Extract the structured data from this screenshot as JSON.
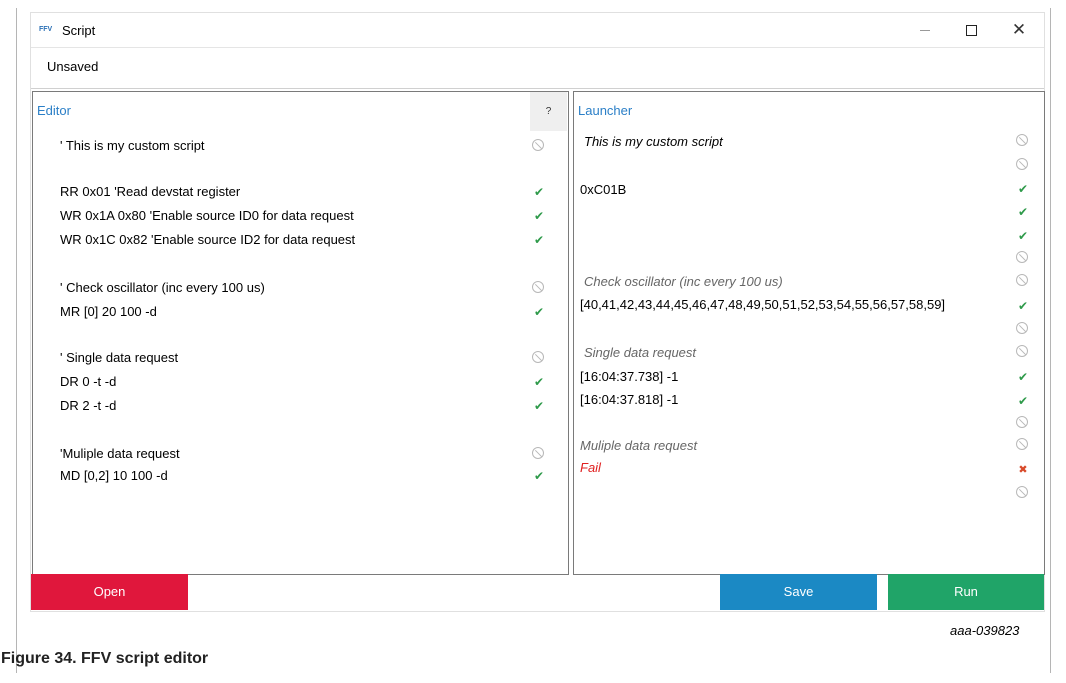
{
  "window": {
    "logo_text": "FFV",
    "title": "Script",
    "status": "Unsaved",
    "controls": {
      "minimize": "—",
      "maximize": "",
      "close": "✕"
    }
  },
  "editor": {
    "title": "Editor",
    "help_label": "?",
    "lines": [
      {
        "text": "' This is my custom script",
        "status": "skip"
      },
      {
        "text": "RR 0x01 'Read devstat register",
        "status": "ok"
      },
      {
        "text": "WR 0x1A 0x80 'Enable source ID0 for data request",
        "status": "ok"
      },
      {
        "text": "WR 0x1C 0x82 'Enable source ID2 for data request",
        "status": "ok"
      },
      {
        "text": "' Check oscillator (inc every 100 us)",
        "status": "skip"
      },
      {
        "text": "MR [0] 20 100 -d",
        "status": "ok"
      },
      {
        "text": "' Single data request",
        "status": "skip"
      },
      {
        "text": "DR 0 -t -d",
        "status": "ok"
      },
      {
        "text": "DR 2 -t -d",
        "status": "ok"
      },
      {
        "text": "'Muliple data request",
        "status": "skip"
      },
      {
        "text": "MD [0,2] 10 100 -d",
        "status": "ok"
      }
    ]
  },
  "launcher": {
    "title": "Launcher",
    "lines": [
      {
        "text": "This is my custom script",
        "style": "title"
      },
      {
        "text": "0xC01B",
        "style": "plain"
      },
      {
        "text": "Check oscillator (inc every 100 us)",
        "style": "comment"
      },
      {
        "text": "[40,41,42,43,44,45,46,47,48,49,50,51,52,53,54,55,56,57,58,59]",
        "style": "plain"
      },
      {
        "text": "Single data request",
        "style": "comment"
      },
      {
        "text": "[16:04:37.738] -1",
        "style": "plain"
      },
      {
        "text": "[16:04:37.818] -1",
        "style": "plain"
      },
      {
        "text": "Muliple data request",
        "style": "comment"
      },
      {
        "text": "Fail",
        "style": "fail"
      }
    ],
    "status_column": [
      "skip",
      "skip",
      "ok",
      "ok",
      "ok",
      "skip",
      "skip",
      "ok",
      "skip",
      "skip",
      "ok",
      "ok",
      "skip",
      "skip",
      "fail",
      "skip"
    ]
  },
  "footer": {
    "open_label": "Open",
    "save_label": "Save",
    "run_label": "Run"
  },
  "figure": {
    "id": "aaa-039823",
    "caption": "Figure 34.  FFV script editor"
  },
  "colors": {
    "accent_blue": "#2b7fc7",
    "open_red": "#e0173c",
    "save_blue": "#1b89c4",
    "run_green": "#20a468",
    "ok_green": "#2e9a4a",
    "fail_red": "#e02020"
  }
}
